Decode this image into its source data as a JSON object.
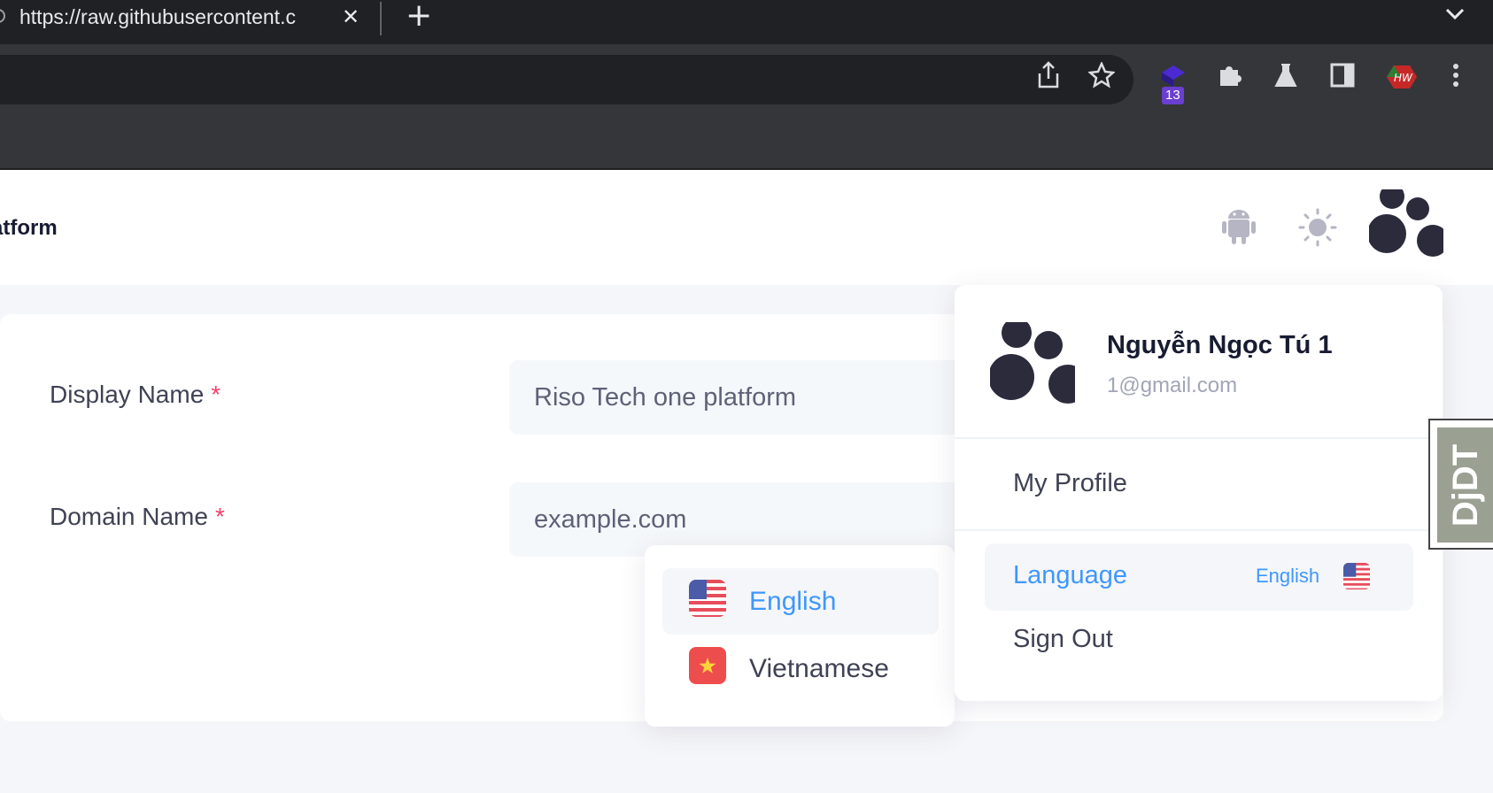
{
  "browser": {
    "tab_title": "https://raw.githubusercontent.c",
    "close_glyph": "✕",
    "newtab_glyph": "+",
    "extension_badge": "13"
  },
  "header": {
    "brand": "atform"
  },
  "form": {
    "display_name_label": "Display Name",
    "display_name_value": "Riso Tech one platform",
    "domain_name_label": "Domain Name",
    "domain_name_placeholder": "example.com",
    "required_mark": "*"
  },
  "language_menu": {
    "options": [
      {
        "label": "English",
        "flag": "us-flag-icon",
        "active": true
      },
      {
        "label": "Vietnamese",
        "flag": "vn-flag-icon",
        "active": false
      }
    ]
  },
  "user_menu": {
    "name": "Nguyễn Ngọc Tú 1",
    "email": "1@gmail.com",
    "my_profile": "My Profile",
    "language_label": "Language",
    "language_current": "English",
    "sign_out": "Sign Out"
  },
  "debug_toolbar": {
    "label": "DjDT"
  },
  "colors": {
    "accent": "#3e97ff",
    "required": "#f1416c",
    "chrome_dark": "#202124",
    "chrome_toolbar": "#35363a"
  }
}
